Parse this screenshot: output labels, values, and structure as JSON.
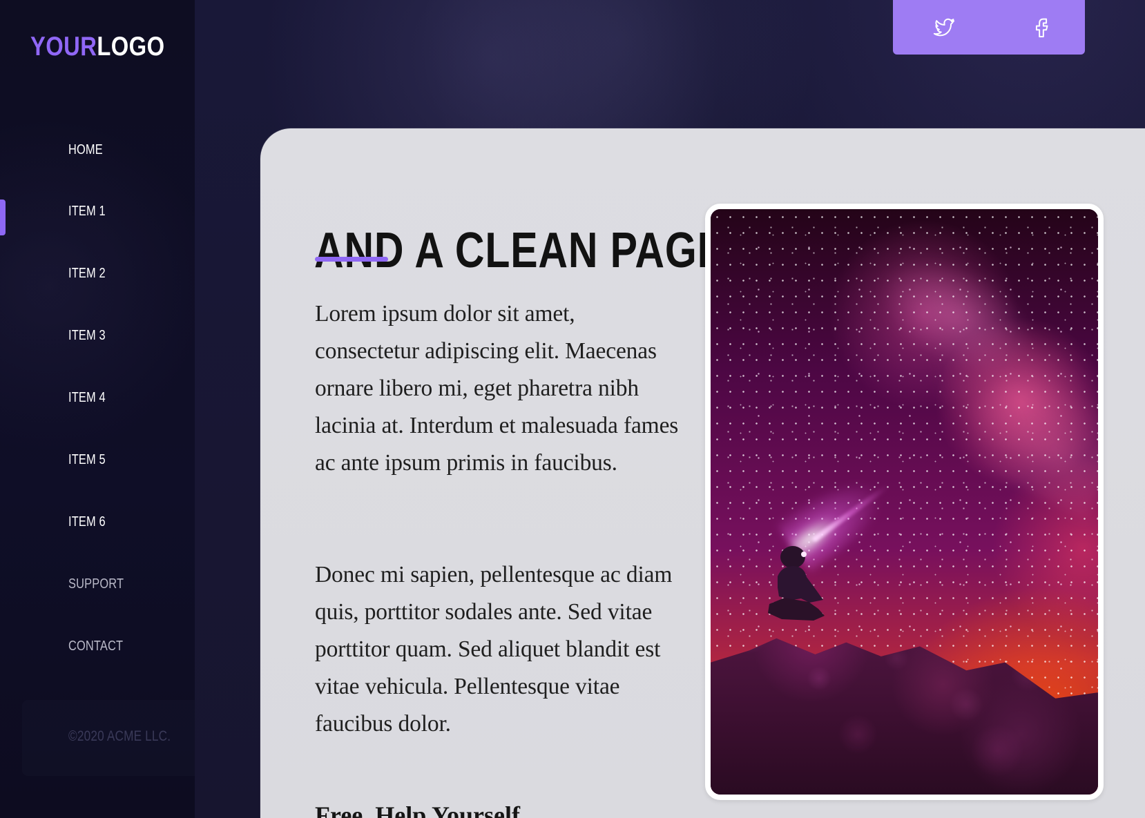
{
  "sidebar": {
    "logo": {
      "part1": "YOUR",
      "part2": "LOGO"
    },
    "items": [
      {
        "label": "HOME"
      },
      {
        "label": "ITEM 1"
      },
      {
        "label": "ITEM 2"
      },
      {
        "label": "ITEM 3"
      },
      {
        "label": "ITEM 4"
      },
      {
        "label": "ITEM 5"
      },
      {
        "label": "ITEM 6"
      },
      {
        "label": "SUPPORT"
      },
      {
        "label": "CONTACT"
      }
    ],
    "copyright": "©2020 ACME LLC."
  },
  "social": {
    "twitter_icon": "twitter-icon",
    "facebook_icon": "facebook-icon"
  },
  "main": {
    "title": "AND A CLEAN PAGE",
    "paragraphs": [
      "Lorem ipsum dolor sit amet, consectetur adipiscing elit. Maecenas ornare libero mi, eget pharetra nibh lacinia at. Interdum et malesuada fames ac ante ipsum primis in faucibus.",
      "Donec mi sapien, pellentesque ac diam quis, porttitor sodales ante. Sed vitae porttitor quam. Sed aliquet blandit est vitae vehicula. Pellentesque vitae faucibus dolor."
    ],
    "subheading": "Free, Help Yourself"
  },
  "colors": {
    "accent": "#8f68f4",
    "social_bar": "#9e7cf3",
    "sidebar_bg": "#0e0d22",
    "card_bg": "#dddde2",
    "text_dark": "#121212"
  }
}
